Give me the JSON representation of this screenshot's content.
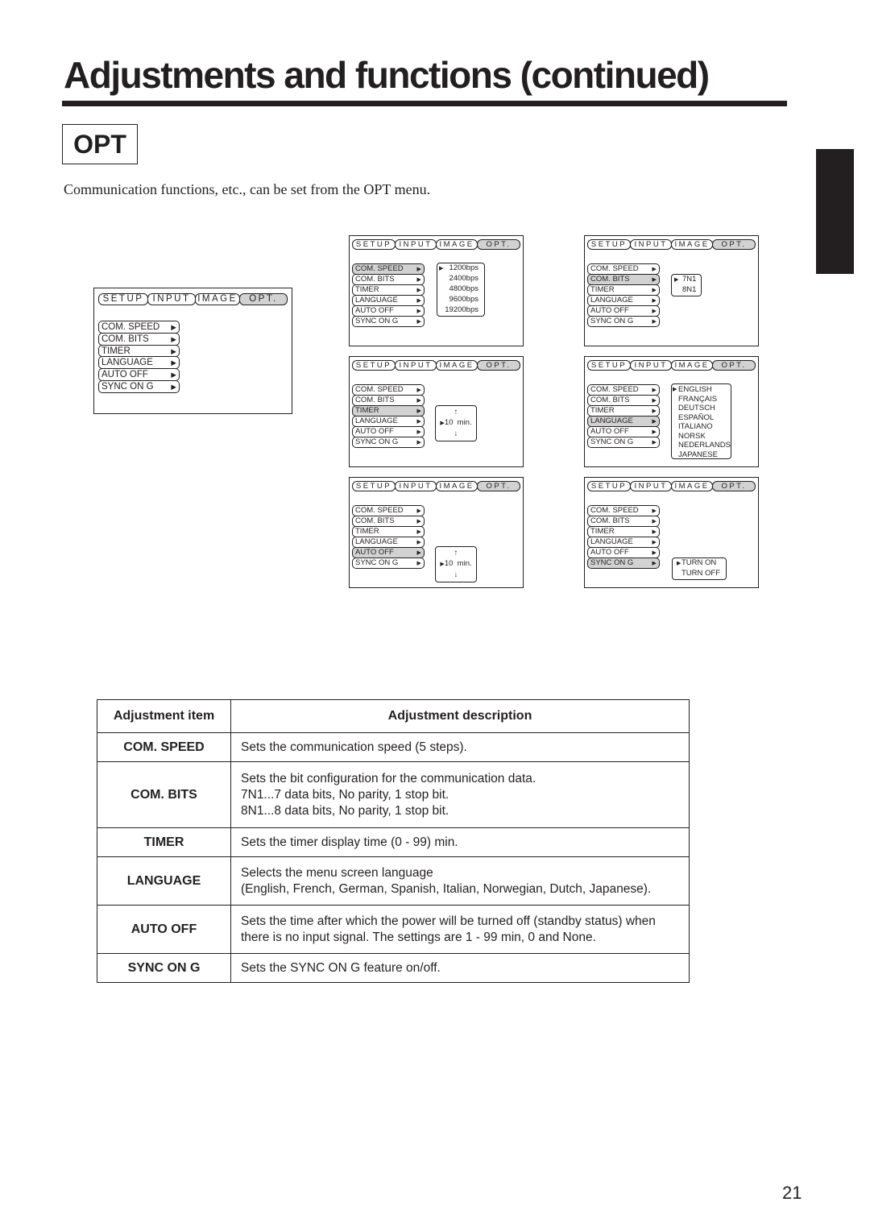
{
  "page": {
    "title": "Adjustments and functions (continued)",
    "section_badge": "OPT",
    "intro": "Communication functions, etc., can be set from the OPT menu.",
    "page_number": "21"
  },
  "osd": {
    "tabs": [
      "SETUP",
      "INPUT",
      "IMAGE",
      "OPT."
    ],
    "active_tab": "OPT.",
    "items": [
      "COM. SPEED",
      "COM. BITS",
      "TIMER",
      "LANGUAGE",
      "AUTO OFF",
      "SYNC ON G"
    ],
    "arrow_icon": "▶",
    "pointer_icon": "▶",
    "up_arrow": "↑",
    "down_arrow": "↓"
  },
  "screens": {
    "com_speed": {
      "selected_item": "COM. SPEED",
      "options": [
        "1200bps",
        "2400bps",
        "4800bps",
        "9600bps",
        "19200bps"
      ],
      "current": "1200bps"
    },
    "com_bits": {
      "selected_item": "COM. BITS",
      "options": [
        "7N1",
        "8N1"
      ],
      "current": "7N1"
    },
    "timer": {
      "selected_item": "TIMER",
      "value": "10  min."
    },
    "language": {
      "selected_item": "LANGUAGE",
      "options": [
        "ENGLISH",
        "FRANÇAIS",
        "DEUTSCH",
        "ESPAÑOL",
        "ITALIANO",
        "NORSK",
        "NEDERLANDS",
        "JAPANESE"
      ],
      "current": "ENGLISH"
    },
    "auto_off": {
      "selected_item": "AUTO OFF",
      "value": "10  min."
    },
    "sync_on_g": {
      "selected_item": "SYNC ON G",
      "options": [
        "TURN ON",
        "TURN OFF"
      ],
      "current": "TURN ON"
    }
  },
  "table": {
    "headers": [
      "Adjustment item",
      "Adjustment description"
    ],
    "rows": [
      {
        "item": "COM. SPEED",
        "lines": [
          "Sets the communication speed (5 steps)."
        ]
      },
      {
        "item": "COM. BITS",
        "lines": [
          "Sets the bit configuration for the communication data.",
          "7N1...7 data bits, No parity, 1 stop bit.",
          "8N1...8 data bits, No parity, 1 stop bit."
        ]
      },
      {
        "item": "TIMER",
        "lines": [
          "Sets the timer display time (0 - 99) min."
        ]
      },
      {
        "item": "LANGUAGE",
        "lines": [
          "Selects the menu screen language",
          "(English, French, German, Spanish, Italian, Norwegian, Dutch, Japanese)."
        ]
      },
      {
        "item": "AUTO OFF",
        "lines": [
          "Sets the time after which the power will be turned off (standby status) when",
          "there is no input signal. The settings are 1 - 99 min, 0 and None."
        ]
      },
      {
        "item": "SYNC ON G",
        "lines": [
          "Sets the SYNC ON G feature on/off."
        ]
      }
    ]
  }
}
